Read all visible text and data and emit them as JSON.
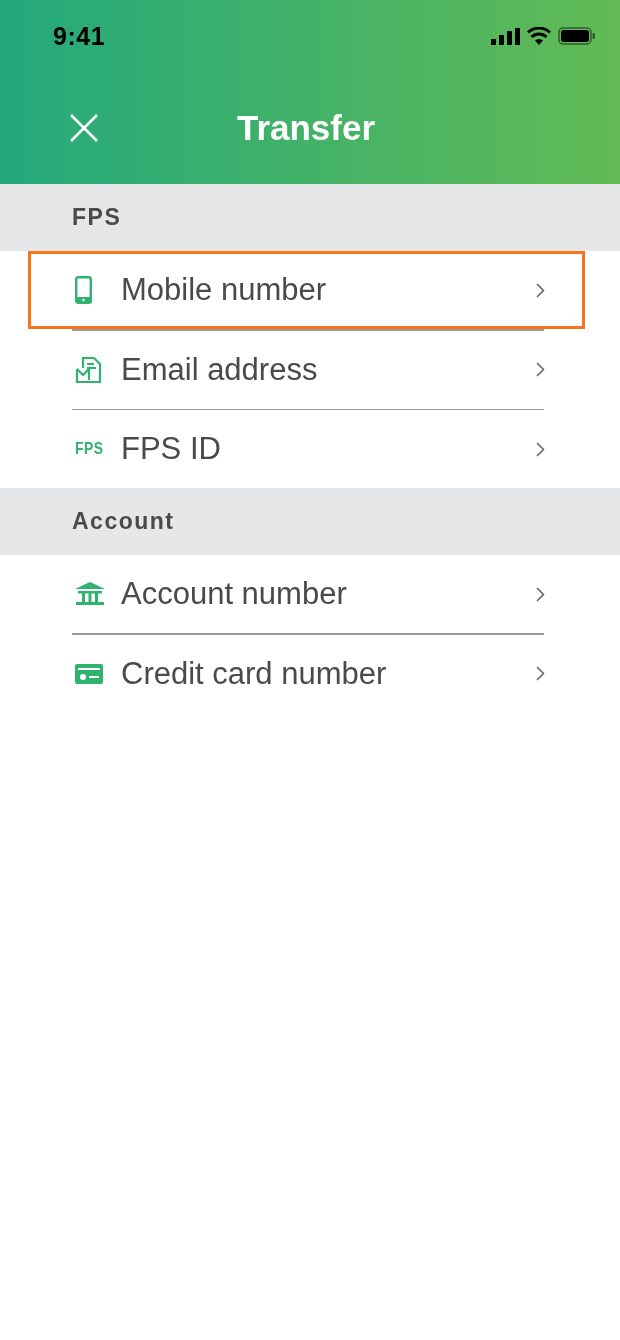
{
  "status_bar": {
    "time": "9:41"
  },
  "header": {
    "title": "Transfer"
  },
  "sections": [
    {
      "title": "FPS",
      "items": [
        {
          "label": "Mobile number",
          "kind": "phone",
          "selected": true
        },
        {
          "label": "Email address",
          "kind": "email",
          "selected": false
        },
        {
          "label": "FPS ID",
          "kind": "fps",
          "icon_text": "FPS",
          "selected": false
        }
      ]
    },
    {
      "title": "Account",
      "items": [
        {
          "label": "Account number",
          "kind": "bank",
          "selected": false
        },
        {
          "label": "Credit card number",
          "kind": "card",
          "selected": false
        }
      ]
    }
  ]
}
